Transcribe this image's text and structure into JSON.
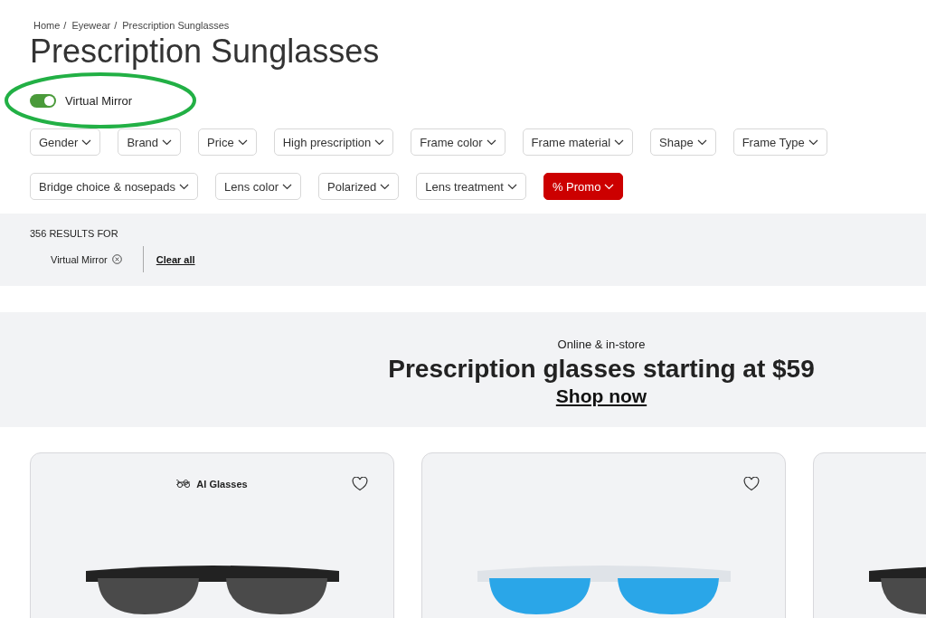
{
  "breadcrumb": [
    "Home",
    "Eyewear",
    "Prescription Sunglasses"
  ],
  "breadcrumb_separator": "/",
  "title": "Prescription Sunglasses",
  "toggle": {
    "label": "Virtual Mirror",
    "on": true
  },
  "filters": [
    {
      "label": "Gender",
      "kind": "plain"
    },
    {
      "label": "Brand",
      "kind": "plain"
    },
    {
      "label": "Price",
      "kind": "plain"
    },
    {
      "label": "High prescription",
      "kind": "plain"
    },
    {
      "label": "Frame color",
      "kind": "plain"
    },
    {
      "label": "Frame material",
      "kind": "plain"
    },
    {
      "label": "Shape",
      "kind": "plain"
    },
    {
      "label": "Frame Type",
      "kind": "plain"
    },
    {
      "label": "Bridge choice & nosepads",
      "kind": "plain"
    },
    {
      "label": "Lens color",
      "kind": "plain"
    },
    {
      "label": "Polarized",
      "kind": "plain"
    },
    {
      "label": "Lens treatment",
      "kind": "plain"
    },
    {
      "label": "% Promo",
      "kind": "promo"
    }
  ],
  "results": {
    "count": "356 RESULTS FOR",
    "active_filters": [
      "Virtual Mirror"
    ],
    "clear": "Clear all"
  },
  "banner": {
    "eyebrow": "Online & in-store",
    "headline": "Prescription glasses starting at $59",
    "link": "Shop now"
  },
  "products": [
    {
      "badge": "AI Glasses",
      "kind": "dark"
    },
    {
      "kind": "blue"
    },
    {
      "kind": "dark"
    }
  ]
}
